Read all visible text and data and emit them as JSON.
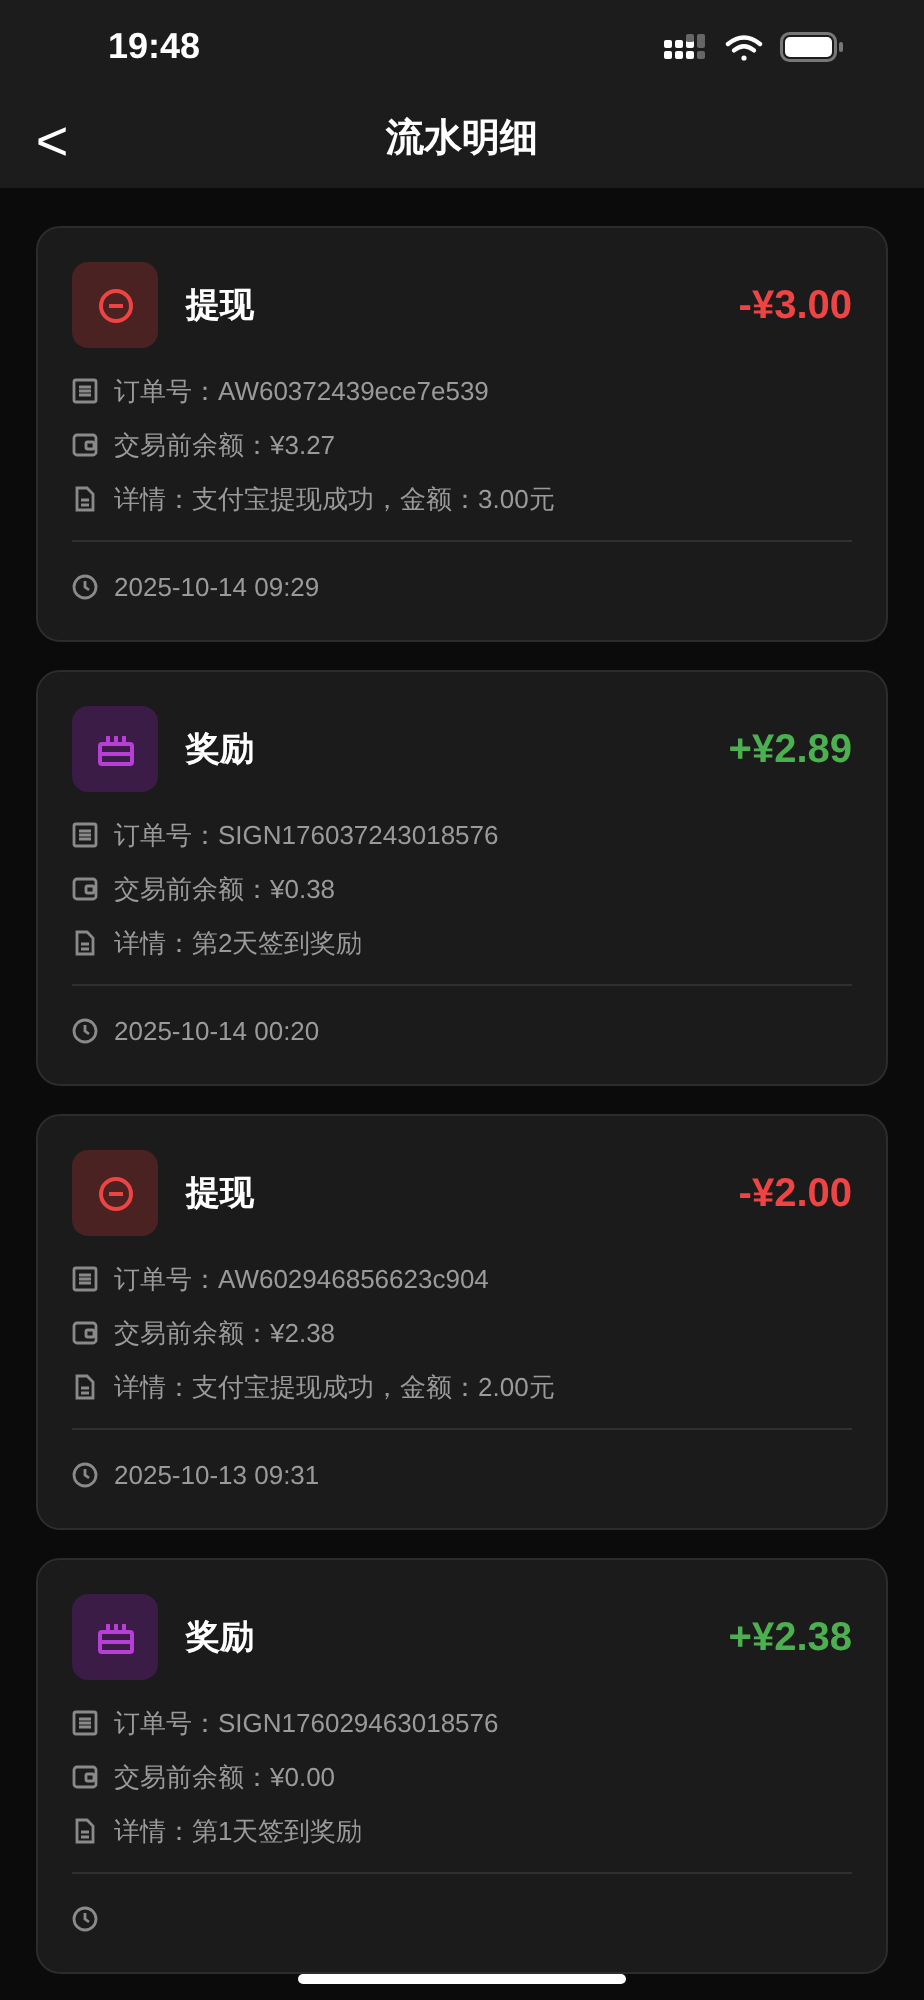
{
  "status_bar": {
    "time": "19:48"
  },
  "nav": {
    "back": "<",
    "title": "流水明细"
  },
  "records": [
    {
      "kind": "withdraw",
      "title": "提现",
      "amount": "-¥3.00",
      "order": "订单号：AW60372439ece7e539",
      "balance": "交易前余额：¥3.27",
      "detail": "详情：支付宝提现成功，金额：3.00元",
      "time": "2025-10-14 09:29"
    },
    {
      "kind": "reward",
      "title": "奖励",
      "amount": "+¥2.89",
      "order": "订单号：SIGN176037243018576",
      "balance": "交易前余额：¥0.38",
      "detail": "详情：第2天签到奖励",
      "time": "2025-10-14 00:20"
    },
    {
      "kind": "withdraw",
      "title": "提现",
      "amount": "-¥2.00",
      "order": "订单号：AW602946856623c904",
      "balance": "交易前余额：¥2.38",
      "detail": "详情：支付宝提现成功，金额：2.00元",
      "time": "2025-10-13 09:31"
    },
    {
      "kind": "reward",
      "title": "奖励",
      "amount": "+¥2.38",
      "order": "订单号：SIGN176029463018576",
      "balance": "交易前余额：¥0.00",
      "detail": "详情：第1天签到奖励"
    }
  ]
}
